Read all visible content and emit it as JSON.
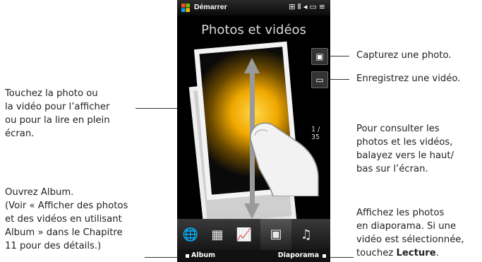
{
  "phone": {
    "status_bar": {
      "start_label": "Démarrer",
      "icons": [
        "windows-logo-icon",
        "connection-icon",
        "signal-icon",
        "volume-icon",
        "battery-icon",
        "menu-icon"
      ]
    },
    "screen_title": "Photos et vidéos",
    "photo_counter": "1 / 35",
    "side_buttons": [
      {
        "icon": "camera-icon",
        "glyph": "▣"
      },
      {
        "icon": "video-camera-icon",
        "glyph": "▭"
      }
    ],
    "tabs": [
      {
        "icon": "globe-icon",
        "glyph": "🌐"
      },
      {
        "icon": "calendar-icon",
        "glyph": "▦"
      },
      {
        "icon": "stocks-icon",
        "glyph": "📈"
      },
      {
        "icon": "photos-icon",
        "glyph": "▣"
      },
      {
        "icon": "music-icon",
        "glyph": "♫"
      }
    ],
    "softkeys": {
      "left": "Album",
      "right": "Diaporama"
    }
  },
  "annotations": {
    "tap_photo": [
      "Touchez la photo ou",
      "la vidéo pour l’afficher",
      "ou pour la lire en plein",
      "écran."
    ],
    "open_album": [
      "Ouvrez Album.",
      "(Voir « Afficher des photos",
      "et des vidéos en utilisant",
      "Album » dans le Chapitre",
      "11 pour des détails.)"
    ],
    "capture_photo": "Capturez une photo.",
    "record_video": "Enregistrez une vidéo.",
    "swipe": [
      "Pour consulter les",
      "photos et les vidéos,",
      "balayez vers le haut/",
      "bas sur l’écran."
    ],
    "slideshow": [
      "Affichez les photos",
      "en diaporama. Si une",
      "vidéo est sélectionnée,"
    ],
    "slideshow_last_prefix": "touchez ",
    "slideshow_last_bold": "Lecture",
    "slideshow_last_suffix": "."
  }
}
